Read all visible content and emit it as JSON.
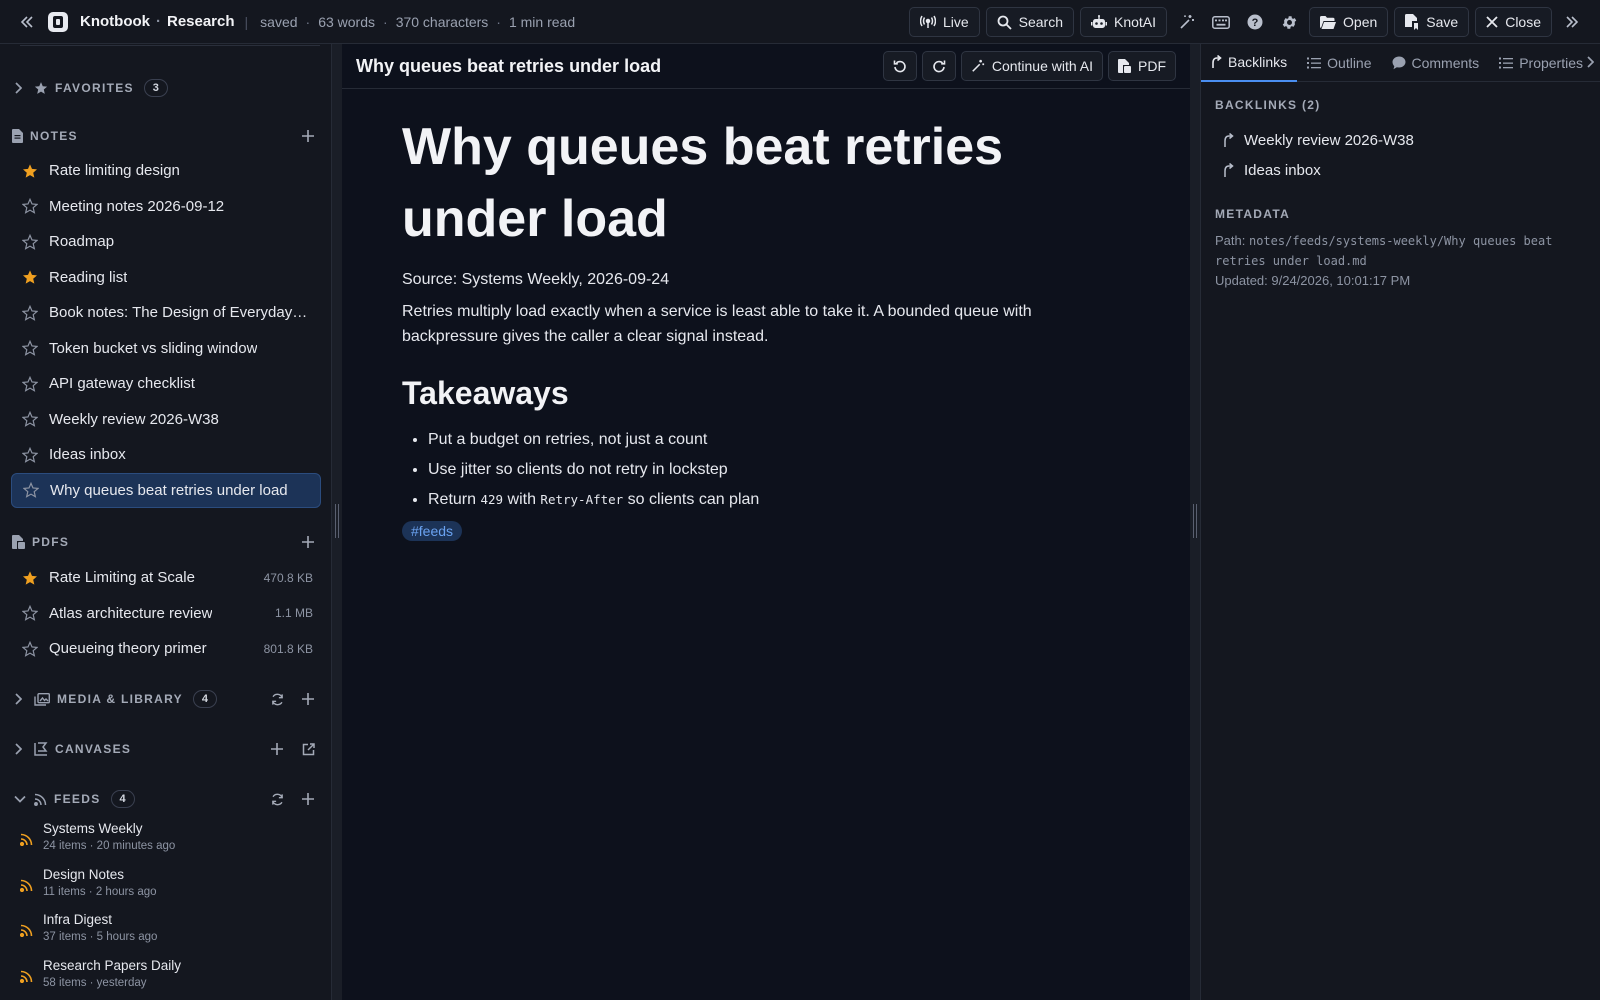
{
  "topbar": {
    "app_name": "Knotbook",
    "separator": "·",
    "vault_name": "Research",
    "status": "saved",
    "word_count": "63 words",
    "char_count": "370 characters",
    "read_time": "1 min read",
    "buttons": {
      "live": "Live",
      "search": "Search",
      "knotai": "KnotAI",
      "open": "Open",
      "save": "Save",
      "close": "Close"
    }
  },
  "sidebar": {
    "favorites": {
      "title": "FAVORITES",
      "count": "3"
    },
    "notes": {
      "title": "NOTES",
      "items": [
        {
          "label": "Rate limiting design",
          "starred": true
        },
        {
          "label": "Meeting notes 2026-09-12",
          "starred": false
        },
        {
          "label": "Roadmap",
          "starred": false
        },
        {
          "label": "Reading list",
          "starred": true
        },
        {
          "label": "Book notes: The Design of Everyday Things",
          "starred": false
        },
        {
          "label": "Token bucket vs sliding window",
          "starred": false
        },
        {
          "label": "API gateway checklist",
          "starred": false
        },
        {
          "label": "Weekly review 2026-W38",
          "starred": false
        },
        {
          "label": "Ideas inbox",
          "starred": false
        },
        {
          "label": "Why queues beat retries under load",
          "starred": false,
          "active": true
        }
      ]
    },
    "pdfs": {
      "title": "PDFS",
      "items": [
        {
          "label": "Rate Limiting at Scale",
          "size": "470.8 KB",
          "starred": true
        },
        {
          "label": "Atlas architecture review",
          "size": "1.1 MB",
          "starred": false
        },
        {
          "label": "Queueing theory primer",
          "size": "801.8 KB",
          "starred": false
        }
      ]
    },
    "media": {
      "title": "MEDIA & LIBRARY",
      "count": "4"
    },
    "canvases": {
      "title": "CANVASES"
    },
    "feeds": {
      "title": "FEEDS",
      "count": "4",
      "items": [
        {
          "name": "Systems Weekly",
          "sub": "24 items · 20 minutes ago"
        },
        {
          "name": "Design Notes",
          "sub": "11 items · 2 hours ago"
        },
        {
          "name": "Infra Digest",
          "sub": "37 items · 5 hours ago"
        },
        {
          "name": "Research Papers Daily",
          "sub": "58 items · yesterday"
        }
      ]
    }
  },
  "editor": {
    "header_title": "Why queues beat retries under load",
    "continue_ai": "Continue with AI",
    "pdf": "PDF",
    "doc": {
      "h1": "Why queues beat retries under load",
      "source": "Source: Systems Weekly, 2026-09-24",
      "lead": "Retries multiply load exactly when a service is least able to take it. A bounded queue with backpressure gives the caller a clear signal instead.",
      "h2": "Takeaways",
      "bullets": {
        "b1": "Put a budget on retries, not just a count",
        "b2": "Use jitter so clients do not retry in lockstep",
        "b3_pre": "Return",
        "b3_code1": "429",
        "b3_mid": "with",
        "b3_code2": "Retry-After",
        "b3_post": "so clients can plan"
      },
      "tag": "#feeds"
    }
  },
  "rpanel": {
    "tabs": [
      "Backlinks",
      "Outline",
      "Comments",
      "Properties"
    ],
    "backlinks_title": "BACKLINKS (2)",
    "backlinks": [
      "Weekly review 2026-W38",
      "Ideas inbox"
    ],
    "metadata_title": "METADATA",
    "path_label": "Path:",
    "path_value": "notes/feeds/systems-weekly/Why queues beat retries under load.md",
    "updated": "Updated: 9/24/2026, 10:01:17 PM"
  },
  "colors": {
    "accent": "#4a8ef0",
    "star": "#f0a020",
    "active_bg": "#1c3357"
  }
}
